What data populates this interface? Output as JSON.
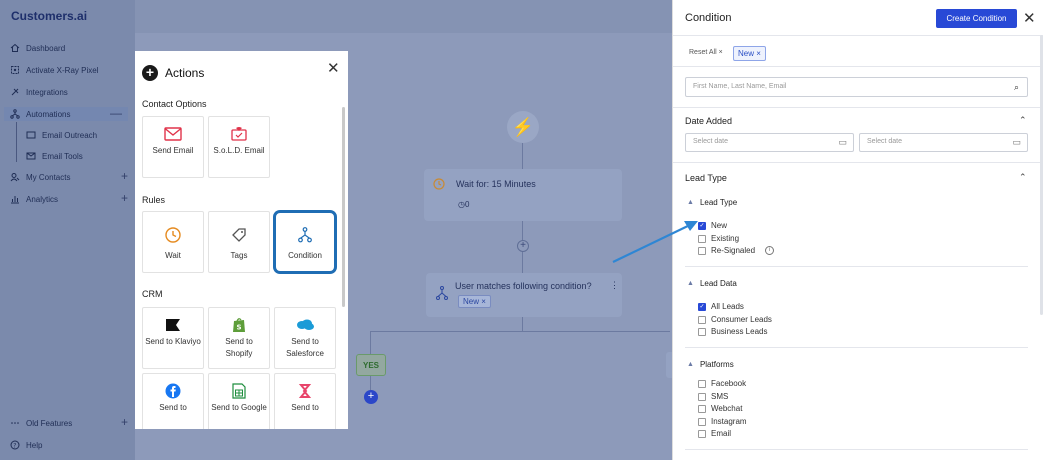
{
  "app": {
    "logo": "Customers.ai"
  },
  "sidebar": {
    "items": [
      {
        "label": "Dashboard",
        "icon": "home-icon"
      },
      {
        "label": "Activate X-Ray Pixel",
        "icon": "pixel-icon"
      },
      {
        "label": "Integrations",
        "icon": "plug-icon"
      },
      {
        "label": "Automations",
        "icon": "automation-icon"
      },
      {
        "label": "Email Outreach",
        "icon": "email-outreach-icon"
      },
      {
        "label": "Email Tools",
        "icon": "email-tools-icon"
      },
      {
        "label": "My Contacts",
        "icon": "contacts-icon"
      },
      {
        "label": "Analytics",
        "icon": "analytics-icon"
      }
    ],
    "bottom": [
      {
        "label": "Old Features",
        "icon": "more-icon"
      },
      {
        "label": "Help",
        "icon": "help-icon"
      }
    ]
  },
  "canvas": {
    "wait_node": {
      "label": "Wait for: 15 Minutes",
      "count": "0"
    },
    "condition_node": {
      "label": "User matches following condition?",
      "chip": "New"
    },
    "yes_label": "YES"
  },
  "actions": {
    "title": "Actions",
    "contact_options": {
      "heading": "Contact Options",
      "cards": [
        {
          "label": "Send Email"
        },
        {
          "label": "S.o.L.D. Email"
        }
      ]
    },
    "rules": {
      "heading": "Rules",
      "cards": [
        {
          "label": "Wait"
        },
        {
          "label": "Tags"
        },
        {
          "label": "Condition"
        }
      ]
    },
    "crm": {
      "heading": "CRM",
      "cards": [
        {
          "label": "Send to Klaviyo"
        },
        {
          "label": "Send to Shopify"
        },
        {
          "label": "Send to Salesforce"
        },
        {
          "label": "Send to"
        },
        {
          "label": "Send to Google"
        },
        {
          "label": "Send to"
        }
      ]
    }
  },
  "panel": {
    "title": "Condition",
    "create_button": "Create Condition",
    "reset_all": "Reset All",
    "active_chip": "New",
    "search": {
      "placeholder": "First Name, Last Name, Email"
    },
    "date_added": {
      "title": "Date Added",
      "from_placeholder": "Select date",
      "to_placeholder": "Select date"
    },
    "lead_type_section": {
      "title": "Lead Type",
      "groups": [
        {
          "title": "Lead Type",
          "options": [
            {
              "label": "New",
              "checked": true
            },
            {
              "label": "Existing",
              "checked": false
            },
            {
              "label": "Re-Signaled",
              "checked": false
            }
          ]
        },
        {
          "title": "Lead Data",
          "options": [
            {
              "label": "All Leads",
              "checked": true
            },
            {
              "label": "Consumer Leads",
              "checked": false
            },
            {
              "label": "Business Leads",
              "checked": false
            }
          ]
        },
        {
          "title": "Platforms",
          "options": [
            {
              "label": "Facebook",
              "checked": false
            },
            {
              "label": "SMS",
              "checked": false
            },
            {
              "label": "Webchat",
              "checked": false
            },
            {
              "label": "Instagram",
              "checked": false
            },
            {
              "label": "Email",
              "checked": false
            }
          ]
        }
      ]
    }
  },
  "colors": {
    "accent": "#2849d6",
    "selected_border": "#1f6db4",
    "annotation_arrow": "#2e86d4"
  }
}
